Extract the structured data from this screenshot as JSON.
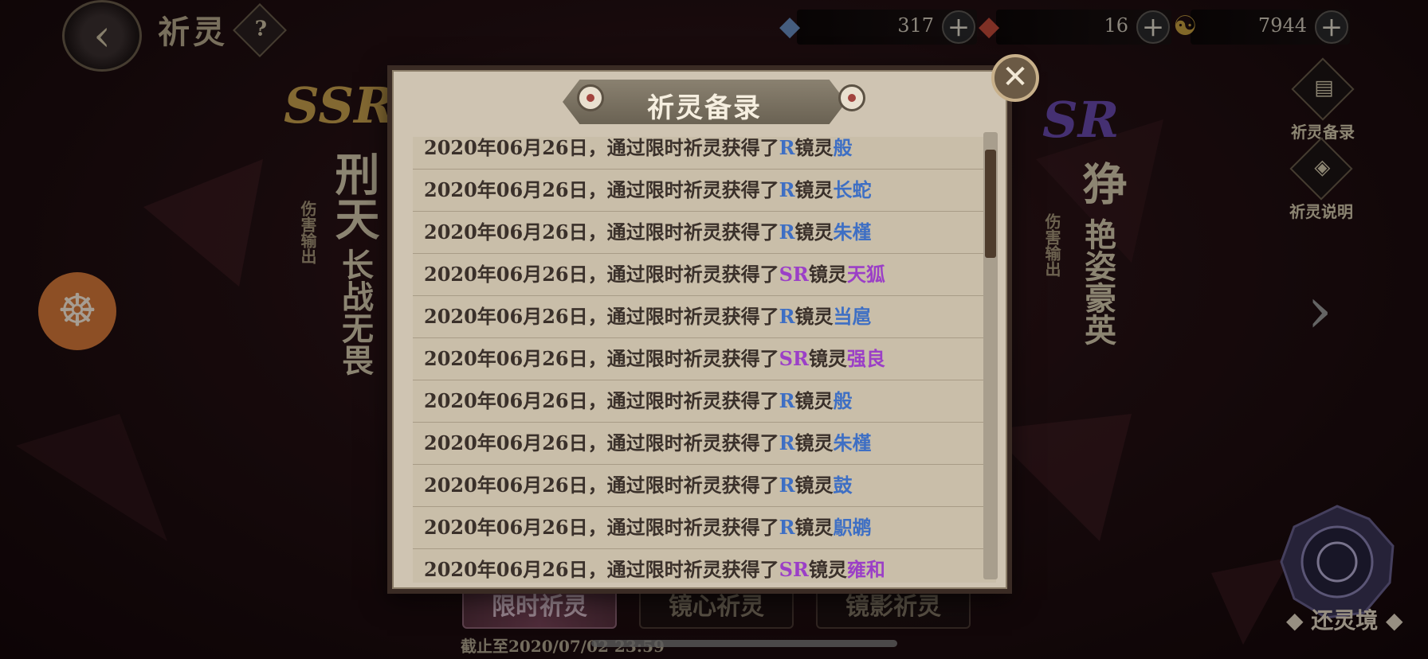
{
  "topbar": {
    "back_icon": "‹",
    "title": "祈灵",
    "help": "?",
    "resources": [
      {
        "name": "blue-crystal",
        "icon": "◆",
        "color": "#6b8fc4",
        "value": "317",
        "plus": "+"
      },
      {
        "name": "red-crystal",
        "icon": "◆",
        "color": "#c44a3a",
        "value": "16",
        "plus": "+"
      },
      {
        "name": "coin",
        "icon": "☯",
        "color": "#c8a040",
        "value": "7944",
        "plus": "+"
      }
    ]
  },
  "left_card": {
    "rarity": "SSR",
    "name": "刑天",
    "role": "伤害输出",
    "motto": "长战无畏"
  },
  "right_card": {
    "rarity": "SR",
    "name": "狰",
    "role": "伤害输出",
    "motto": "艳姿豪英"
  },
  "side_menu": {
    "records_label": "祈灵备录",
    "info_label": "祈灵说明"
  },
  "hand_icon": "☸",
  "next_icon": "›",
  "tabs": [
    {
      "label": "限时祈灵",
      "active": true
    },
    {
      "label": "镜心祈灵",
      "active": false
    },
    {
      "label": "镜影祈灵",
      "active": false
    }
  ],
  "deadline": "截止至2020/07/02 23:59",
  "portal_label": "◆ 还灵境 ◆",
  "modal": {
    "title": "祈灵备录",
    "close": "✕",
    "records": [
      {
        "date": "2020年06月26日，",
        "text": "通过限时祈灵获得了",
        "rarity": "R",
        "kind": "镜灵",
        "name": "般"
      },
      {
        "date": "2020年06月26日，",
        "text": "通过限时祈灵获得了",
        "rarity": "R",
        "kind": "镜灵",
        "name": "长蛇"
      },
      {
        "date": "2020年06月26日，",
        "text": "通过限时祈灵获得了",
        "rarity": "R",
        "kind": "镜灵",
        "name": "朱槿"
      },
      {
        "date": "2020年06月26日，",
        "text": "通过限时祈灵获得了",
        "rarity": "SR",
        "kind": "镜灵",
        "name": "天狐"
      },
      {
        "date": "2020年06月26日，",
        "text": "通过限时祈灵获得了",
        "rarity": "R",
        "kind": "镜灵",
        "name": "当扈"
      },
      {
        "date": "2020年06月26日，",
        "text": "通过限时祈灵获得了",
        "rarity": "SR",
        "kind": "镜灵",
        "name": "强良"
      },
      {
        "date": "2020年06月26日，",
        "text": "通过限时祈灵获得了",
        "rarity": "R",
        "kind": "镜灵",
        "name": "般"
      },
      {
        "date": "2020年06月26日，",
        "text": "通过限时祈灵获得了",
        "rarity": "R",
        "kind": "镜灵",
        "name": "朱槿"
      },
      {
        "date": "2020年06月26日，",
        "text": "通过限时祈灵获得了",
        "rarity": "R",
        "kind": "镜灵",
        "name": "鼓"
      },
      {
        "date": "2020年06月26日，",
        "text": "通过限时祈灵获得了",
        "rarity": "R",
        "kind": "镜灵",
        "name": "䳅鹕"
      },
      {
        "date": "2020年06月26日，",
        "text": "通过限时祈灵获得了",
        "rarity": "SR",
        "kind": "镜灵",
        "name": "雍和"
      }
    ]
  }
}
